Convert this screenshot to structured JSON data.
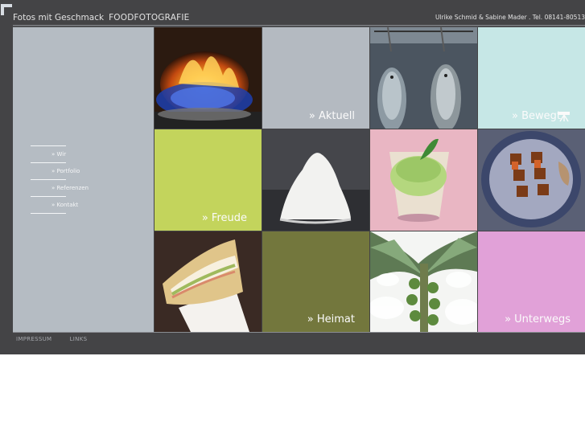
{
  "header": {
    "brand_name": "Fotos mit Geschmack",
    "brand_sub": "FOODFOTOGRAFIE",
    "contact": "Ulrike Schmid & Sabine Mader . Tel. 08141-80513"
  },
  "sidebar": {
    "items": [
      {
        "label": "» Wir"
      },
      {
        "label": "» Portfolio"
      },
      {
        "label": "» Referenzen"
      },
      {
        "label": "» Kontakt"
      }
    ]
  },
  "tiles": {
    "aktuell": "» Aktuell",
    "bewegt": "» Bewegt",
    "freude": "» Freude",
    "heimat": "» Heimat",
    "unterwegs": "» Unterwegs"
  },
  "footer": {
    "impressum": "IMPRESSUM",
    "links": "LINKS"
  },
  "colors": {
    "frame": "#444446",
    "sidebar": "#b5bcc3",
    "aktuell": "#b4bac1",
    "bewegt": "#c6e7e6",
    "freude": "#c3d45c",
    "heimat": "#73773d",
    "unterwegs": "#e1a1d8"
  },
  "icons": [
    "camera-icon"
  ]
}
